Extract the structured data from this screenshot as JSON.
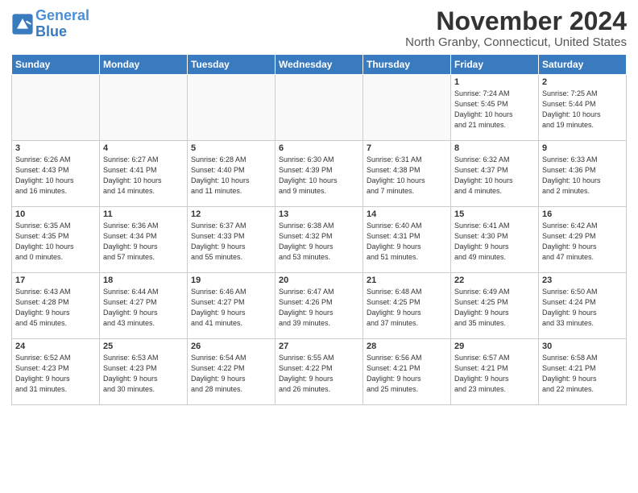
{
  "header": {
    "logo_line1": "General",
    "logo_line2": "Blue",
    "month": "November 2024",
    "location": "North Granby, Connecticut, United States"
  },
  "weekdays": [
    "Sunday",
    "Monday",
    "Tuesday",
    "Wednesday",
    "Thursday",
    "Friday",
    "Saturday"
  ],
  "weeks": [
    [
      {
        "day": "",
        "info": ""
      },
      {
        "day": "",
        "info": ""
      },
      {
        "day": "",
        "info": ""
      },
      {
        "day": "",
        "info": ""
      },
      {
        "day": "",
        "info": ""
      },
      {
        "day": "1",
        "info": "Sunrise: 7:24 AM\nSunset: 5:45 PM\nDaylight: 10 hours\nand 21 minutes."
      },
      {
        "day": "2",
        "info": "Sunrise: 7:25 AM\nSunset: 5:44 PM\nDaylight: 10 hours\nand 19 minutes."
      }
    ],
    [
      {
        "day": "3",
        "info": "Sunrise: 6:26 AM\nSunset: 4:43 PM\nDaylight: 10 hours\nand 16 minutes."
      },
      {
        "day": "4",
        "info": "Sunrise: 6:27 AM\nSunset: 4:41 PM\nDaylight: 10 hours\nand 14 minutes."
      },
      {
        "day": "5",
        "info": "Sunrise: 6:28 AM\nSunset: 4:40 PM\nDaylight: 10 hours\nand 11 minutes."
      },
      {
        "day": "6",
        "info": "Sunrise: 6:30 AM\nSunset: 4:39 PM\nDaylight: 10 hours\nand 9 minutes."
      },
      {
        "day": "7",
        "info": "Sunrise: 6:31 AM\nSunset: 4:38 PM\nDaylight: 10 hours\nand 7 minutes."
      },
      {
        "day": "8",
        "info": "Sunrise: 6:32 AM\nSunset: 4:37 PM\nDaylight: 10 hours\nand 4 minutes."
      },
      {
        "day": "9",
        "info": "Sunrise: 6:33 AM\nSunset: 4:36 PM\nDaylight: 10 hours\nand 2 minutes."
      }
    ],
    [
      {
        "day": "10",
        "info": "Sunrise: 6:35 AM\nSunset: 4:35 PM\nDaylight: 10 hours\nand 0 minutes."
      },
      {
        "day": "11",
        "info": "Sunrise: 6:36 AM\nSunset: 4:34 PM\nDaylight: 9 hours\nand 57 minutes."
      },
      {
        "day": "12",
        "info": "Sunrise: 6:37 AM\nSunset: 4:33 PM\nDaylight: 9 hours\nand 55 minutes."
      },
      {
        "day": "13",
        "info": "Sunrise: 6:38 AM\nSunset: 4:32 PM\nDaylight: 9 hours\nand 53 minutes."
      },
      {
        "day": "14",
        "info": "Sunrise: 6:40 AM\nSunset: 4:31 PM\nDaylight: 9 hours\nand 51 minutes."
      },
      {
        "day": "15",
        "info": "Sunrise: 6:41 AM\nSunset: 4:30 PM\nDaylight: 9 hours\nand 49 minutes."
      },
      {
        "day": "16",
        "info": "Sunrise: 6:42 AM\nSunset: 4:29 PM\nDaylight: 9 hours\nand 47 minutes."
      }
    ],
    [
      {
        "day": "17",
        "info": "Sunrise: 6:43 AM\nSunset: 4:28 PM\nDaylight: 9 hours\nand 45 minutes."
      },
      {
        "day": "18",
        "info": "Sunrise: 6:44 AM\nSunset: 4:27 PM\nDaylight: 9 hours\nand 43 minutes."
      },
      {
        "day": "19",
        "info": "Sunrise: 6:46 AM\nSunset: 4:27 PM\nDaylight: 9 hours\nand 41 minutes."
      },
      {
        "day": "20",
        "info": "Sunrise: 6:47 AM\nSunset: 4:26 PM\nDaylight: 9 hours\nand 39 minutes."
      },
      {
        "day": "21",
        "info": "Sunrise: 6:48 AM\nSunset: 4:25 PM\nDaylight: 9 hours\nand 37 minutes."
      },
      {
        "day": "22",
        "info": "Sunrise: 6:49 AM\nSunset: 4:25 PM\nDaylight: 9 hours\nand 35 minutes."
      },
      {
        "day": "23",
        "info": "Sunrise: 6:50 AM\nSunset: 4:24 PM\nDaylight: 9 hours\nand 33 minutes."
      }
    ],
    [
      {
        "day": "24",
        "info": "Sunrise: 6:52 AM\nSunset: 4:23 PM\nDaylight: 9 hours\nand 31 minutes."
      },
      {
        "day": "25",
        "info": "Sunrise: 6:53 AM\nSunset: 4:23 PM\nDaylight: 9 hours\nand 30 minutes."
      },
      {
        "day": "26",
        "info": "Sunrise: 6:54 AM\nSunset: 4:22 PM\nDaylight: 9 hours\nand 28 minutes."
      },
      {
        "day": "27",
        "info": "Sunrise: 6:55 AM\nSunset: 4:22 PM\nDaylight: 9 hours\nand 26 minutes."
      },
      {
        "day": "28",
        "info": "Sunrise: 6:56 AM\nSunset: 4:21 PM\nDaylight: 9 hours\nand 25 minutes."
      },
      {
        "day": "29",
        "info": "Sunrise: 6:57 AM\nSunset: 4:21 PM\nDaylight: 9 hours\nand 23 minutes."
      },
      {
        "day": "30",
        "info": "Sunrise: 6:58 AM\nSunset: 4:21 PM\nDaylight: 9 hours\nand 22 minutes."
      }
    ]
  ]
}
